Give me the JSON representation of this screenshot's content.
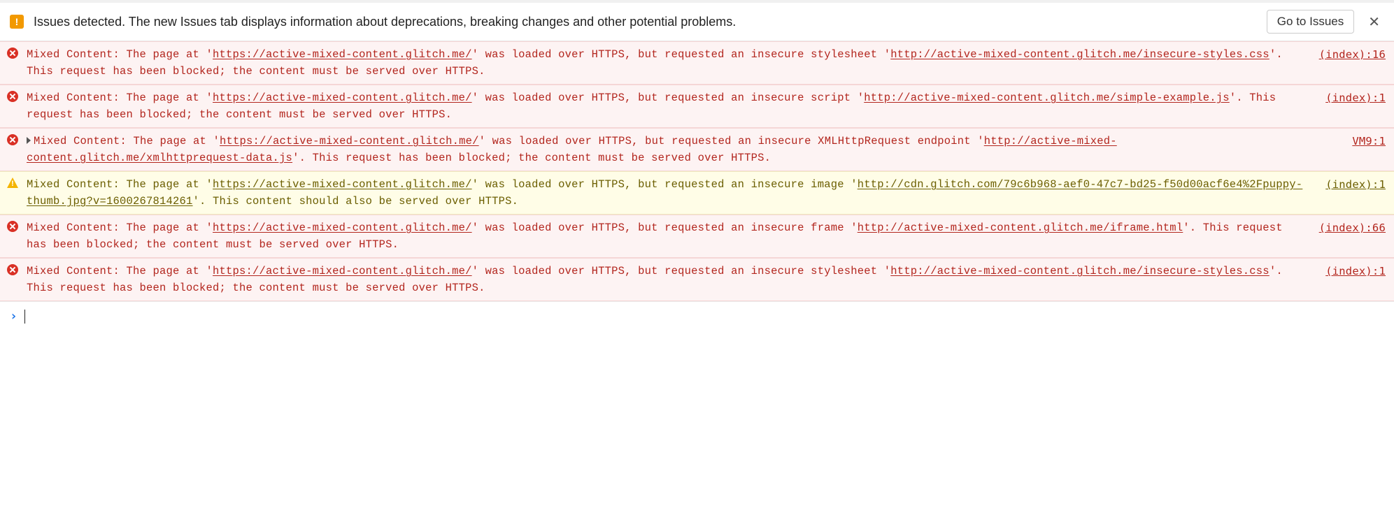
{
  "issuesBar": {
    "text": "Issues detected. The new Issues tab displays information about deprecations, breaking changes and other potential problems.",
    "button": "Go to Issues"
  },
  "pageUrl": "https://active-mixed-content.glitch.me/",
  "rows": [
    {
      "level": "error",
      "hasCaret": false,
      "source": "(index):16",
      "pre1": "Mixed Content: The page at '",
      "url1": "https://active-mixed-content.glitch.me/",
      "mid": "' was loaded over HTTPS, but requested an insecure stylesheet '",
      "url2": "http://active-mixed-content.glitch.me/insecure-styles.css",
      "post": "'. This request has been blocked; the content must be served over HTTPS."
    },
    {
      "level": "error",
      "hasCaret": false,
      "source": "(index):1",
      "pre1": "Mixed Content: The page at '",
      "url1": "https://active-mixed-content.glitch.me/",
      "mid": "' was loaded over HTTPS, but requested an insecure script '",
      "url2": "http://active-mixed-content.glitch.me/simple-example.js",
      "post": "'. This request has been blocked; the content must be served over HTTPS."
    },
    {
      "level": "error",
      "hasCaret": true,
      "source": "VM9:1",
      "pre1": "Mixed Content: The page at '",
      "url1": "https://active-mixed-content.glitch.me/",
      "mid": "' was loaded over HTTPS, but requested an insecure XMLHttpRequest endpoint '",
      "url2": "http://active-mixed-content.glitch.me/xmlhttprequest-data.js",
      "post": "'. This request has been blocked; the content must be served over HTTPS."
    },
    {
      "level": "warning",
      "hasCaret": false,
      "source": "(index):1",
      "pre1": "Mixed Content: The page at '",
      "url1": "https://active-mixed-content.glitch.me/",
      "mid": "' was loaded over HTTPS, but requested an insecure image '",
      "url2": "http://cdn.glitch.com/79c6b968-aef0-47c7-bd25-f50d00acf6e4%2Fpuppy-thumb.jpg?v=1600267814261",
      "post": "'. This content should also be served over HTTPS."
    },
    {
      "level": "error",
      "hasCaret": false,
      "source": "(index):66",
      "pre1": "Mixed Content: The page at '",
      "url1": "https://active-mixed-content.glitch.me/",
      "mid": "' was loaded over HTTPS, but requested an insecure frame '",
      "url2": "http://active-mixed-content.glitch.me/iframe.html",
      "post": "'. This request has been blocked; the content must be served over HTTPS."
    },
    {
      "level": "error",
      "hasCaret": false,
      "source": "(index):1",
      "pre1": "Mixed Content: The page at '",
      "url1": "https://active-mixed-content.glitch.me/",
      "mid": "' was loaded over HTTPS, but requested an insecure stylesheet '",
      "url2": "http://active-mixed-content.glitch.me/insecure-styles.css",
      "post": "'. This request has been blocked; the content must be served over HTTPS."
    }
  ],
  "prompt": "›"
}
